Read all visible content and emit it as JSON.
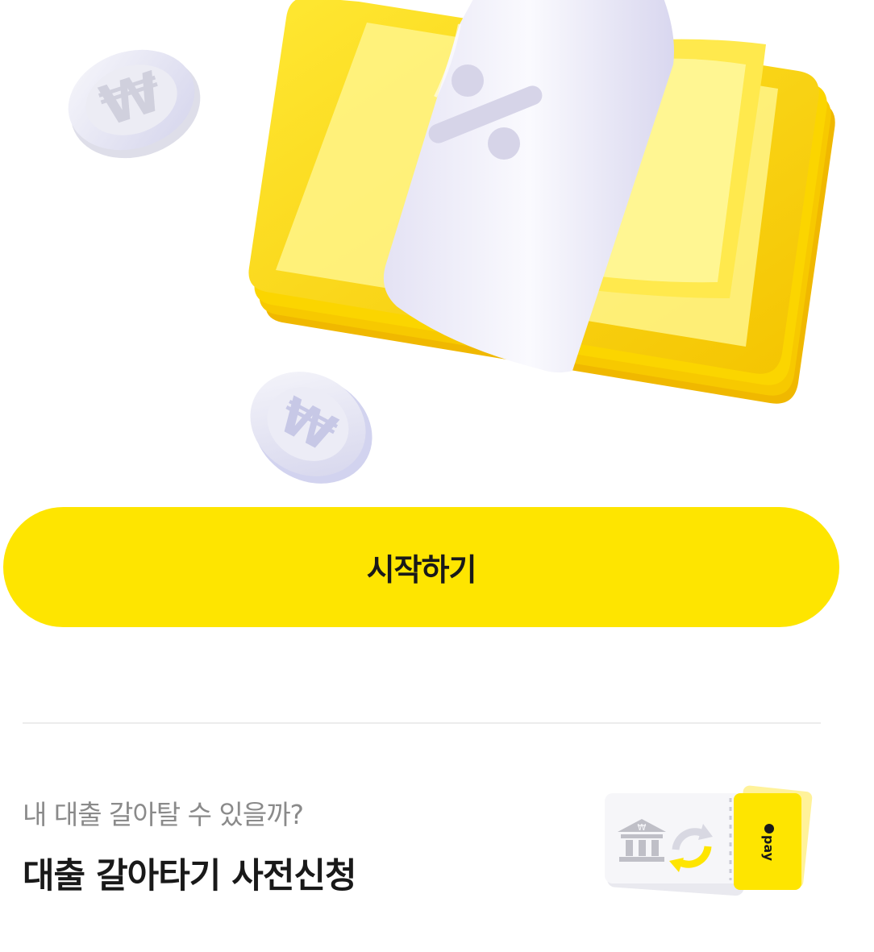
{
  "hero": {
    "illustration": "money-bundle-percent-band-with-won-coins"
  },
  "cta": {
    "label": "시작하기",
    "color": "#FEE500"
  },
  "promo": {
    "subtitle": "내 대출 갈아탈 수 있을까?",
    "title": "대출 갈아타기 사전신청",
    "art": {
      "bank_icon": "bank-icon",
      "refresh_icon": "refresh-arrow-icon",
      "ticket_text": "pay"
    }
  }
}
